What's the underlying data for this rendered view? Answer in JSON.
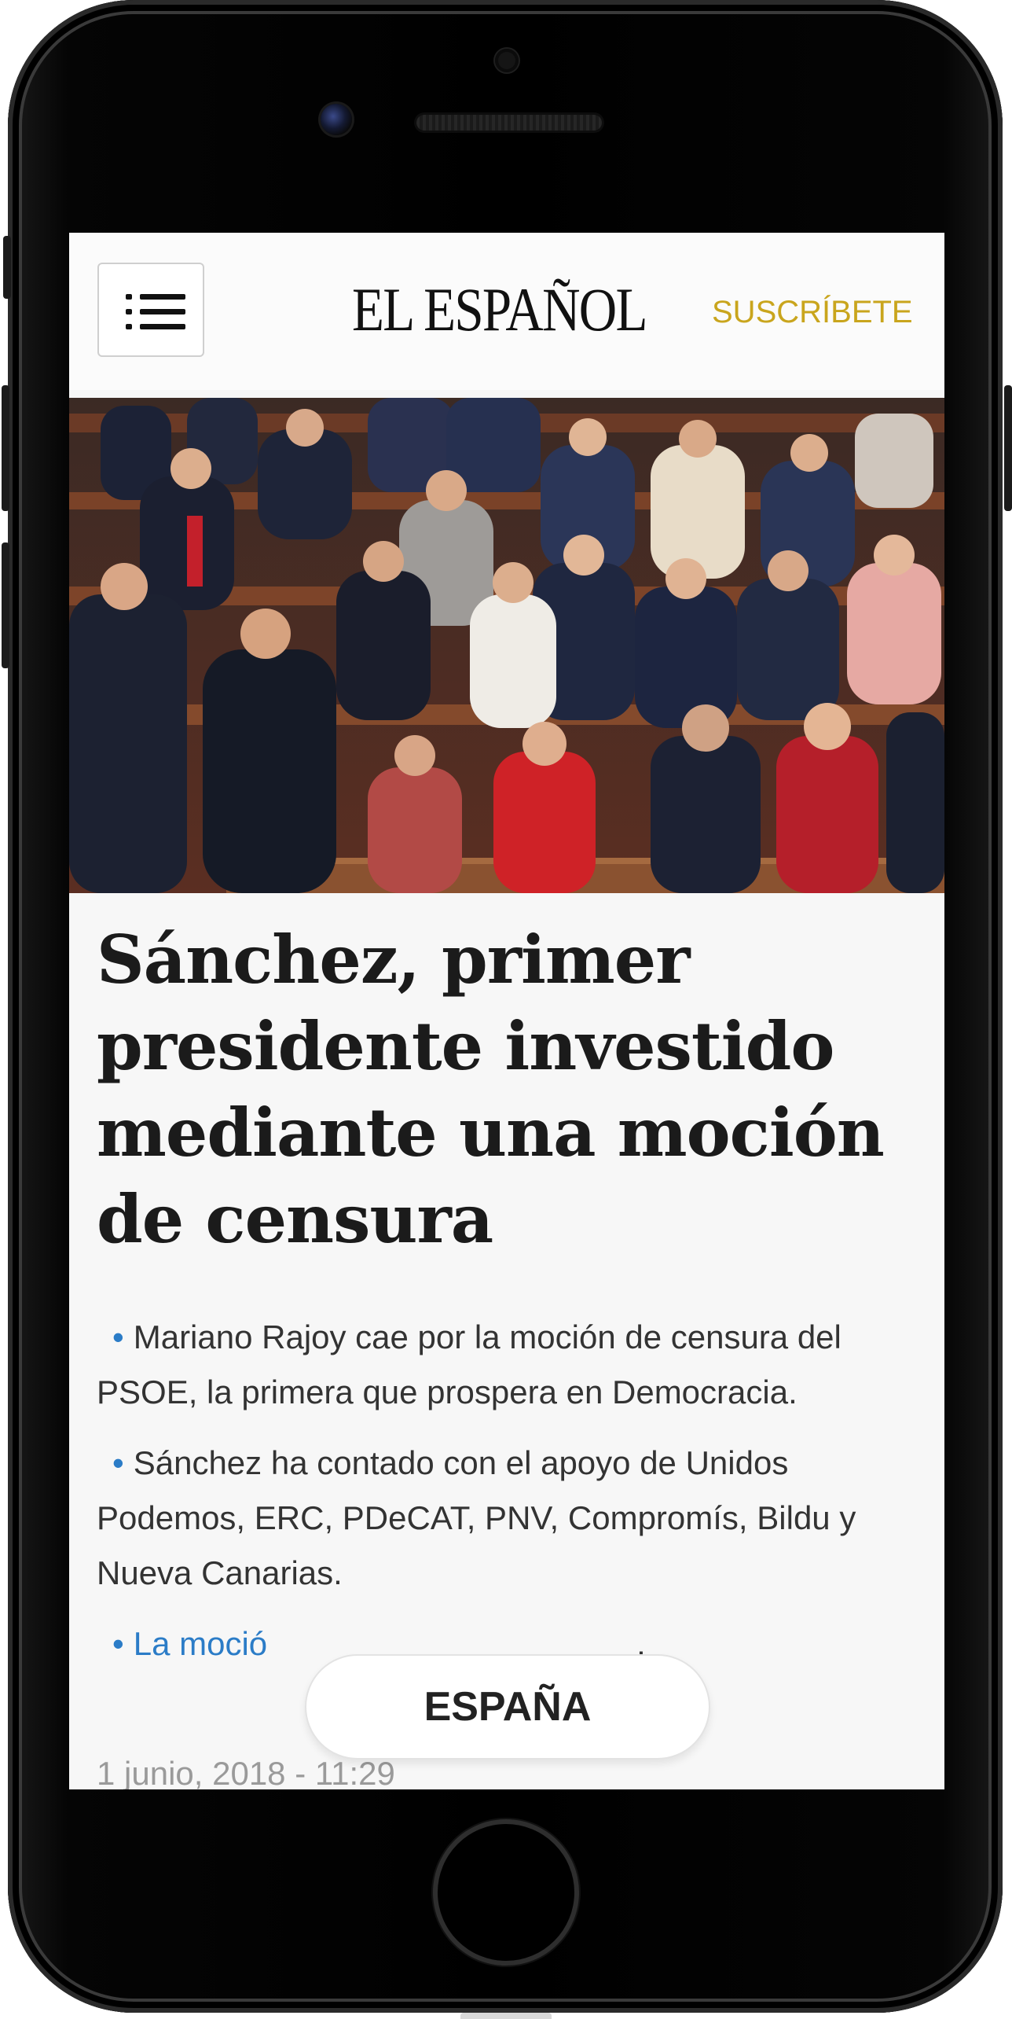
{
  "header": {
    "logo_text": "EL ESPAÑOL",
    "subscribe_label": "SUSCRÍBETE"
  },
  "hero_image": {
    "description_icon": "photo-parliament-applause"
  },
  "article": {
    "headline": "Sánchez, primer presidente investido mediante una moción de censura",
    "bullets": [
      "Mariano Rajoy cae por la moción de censura del PSOE, la primera que prospera en Democracia.",
      "Sánchez ha contado con el apoyo de Unidos Podemos, ERC, PDeCAT, PNV, Compromís, Bildu y Nueva Canarias.",
      "La moció"
    ],
    "bullet_tail": ".",
    "dateline": "1 junio, 2018 - 11:29"
  },
  "section_pill": {
    "label": "ESPAÑA"
  },
  "colors": {
    "accent_gold": "#c9a51d",
    "link_blue": "#2b7cc7",
    "headline": "#1b1b1b",
    "body_text": "#333333"
  },
  "icons": {
    "menu": "hamburger-menu-icon",
    "bullet": "bullet-dot-icon"
  }
}
